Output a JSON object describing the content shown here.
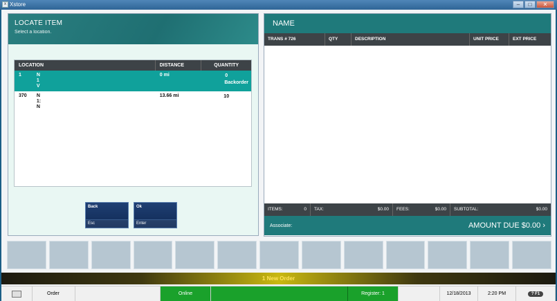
{
  "window": {
    "title": "Xstore",
    "app_icon": "xstore-icon",
    "controls": [
      "minimize-icon",
      "maximize-icon",
      "close-icon"
    ]
  },
  "locate": {
    "title": "LOCATE ITEM",
    "subtitle": "Select a location.",
    "columns": [
      "LOCATION",
      "DISTANCE",
      "QUANTITY"
    ],
    "rows": [
      {
        "id": "1",
        "address": "N\n1\nV",
        "distance": "0 mi",
        "quantity": "0",
        "status": "Backorder",
        "selected": true
      },
      {
        "id": "370",
        "address": "N\n1:\nN",
        "distance": "13.66 mi",
        "quantity": "10",
        "status": "",
        "selected": false
      }
    ],
    "back_button": {
      "label": "Back",
      "key": "Esc"
    },
    "ok_button": {
      "label": "Ok",
      "key": "Enter"
    }
  },
  "transaction": {
    "title": "NAME",
    "columns": {
      "trans": "TRANS # 726",
      "qty": "QTY",
      "description": "DESCRIPTION",
      "unit_price": "UNIT PRICE",
      "ext_price": "EXT PRICE"
    },
    "totals": {
      "items_label": "ITEMS:",
      "items": "0",
      "tax_label": "TAX:",
      "tax": "$0.00",
      "fees_label": "FEES:",
      "fees": "$0.00",
      "subtotal_label": "SUBTOTAL:",
      "subtotal": "$0.00"
    },
    "associate_label": "Associate:",
    "amount_due": "AMOUNT DUE  $0.00 ›"
  },
  "notification": "1 New Order",
  "status_bar": {
    "mode": "Order",
    "connection": "Online",
    "register": "Register: 1",
    "date": "12/18/2013",
    "time": "2:20 PM",
    "help": "? F1"
  },
  "colors": {
    "teal": "#1f7a7b",
    "selected_row": "#10a19b",
    "online_green": "#1aa12b",
    "notice_text": "#ffe35a"
  }
}
